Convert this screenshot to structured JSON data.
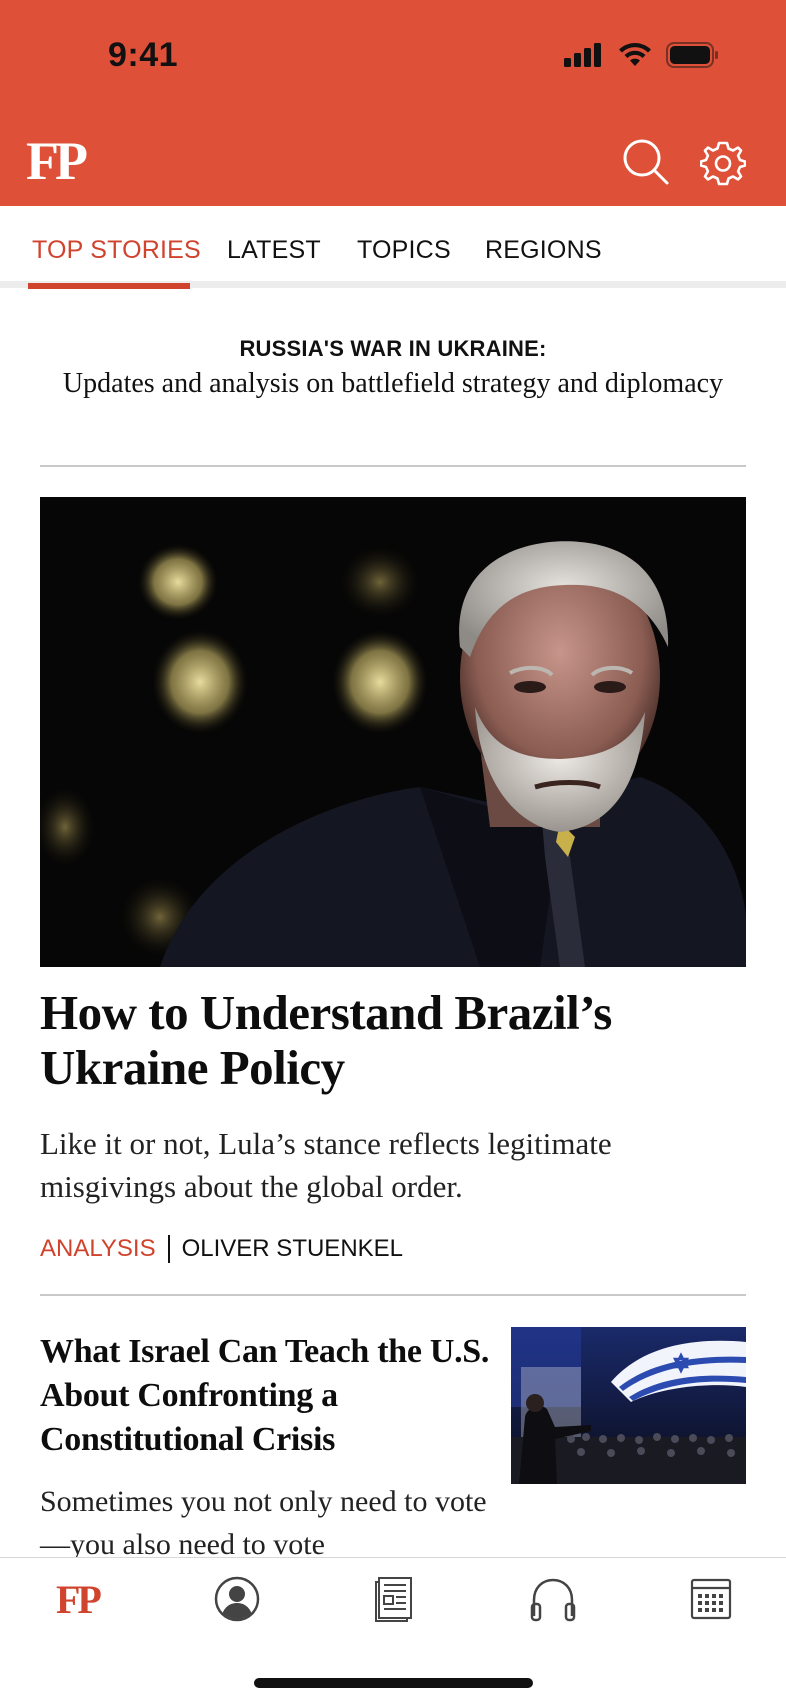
{
  "status_bar": {
    "time": "9:41"
  },
  "header": {
    "logo": "FP",
    "search_icon": "search-icon",
    "settings_icon": "gear-icon"
  },
  "tabs": [
    {
      "label": "TOP STORIES",
      "active": true
    },
    {
      "label": "LATEST",
      "active": false
    },
    {
      "label": "TOPICS",
      "active": false
    },
    {
      "label": "REGIONS",
      "active": false
    }
  ],
  "banner": {
    "kicker": "RUSSIA'S WAR IN UKRAINE:",
    "text": "Updates and analysis on battlefield strategy and diplomacy"
  },
  "lead_story": {
    "title": "How to Understand Brazil’s Ukraine Policy",
    "dek": "Like it or not, Lula’s stance reflects legitimate misgivings about the global order.",
    "tag": "ANALYSIS",
    "author": "OLIVER STUENKEL"
  },
  "second_story": {
    "title": "What Israel Can Teach the U.S. About Confronting a Constitutional Crisis",
    "dek": "Sometimes you not only need to vote—you also need to vote"
  },
  "bottom_nav": {
    "items": [
      {
        "label": "FP",
        "icon": "fp-logo-icon",
        "active": true
      },
      {
        "icon": "profile-icon"
      },
      {
        "icon": "magazine-icon"
      },
      {
        "icon": "headphones-icon"
      },
      {
        "icon": "calendar-icon"
      }
    ]
  },
  "colors": {
    "brand": "#DF5038",
    "accent": "#D0432D"
  }
}
